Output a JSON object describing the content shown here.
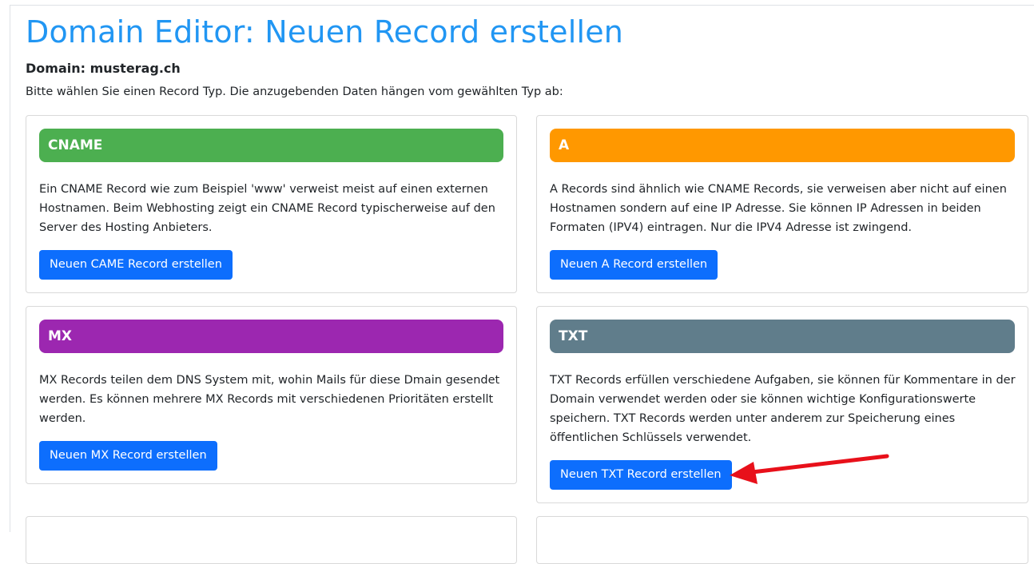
{
  "page": {
    "title": "Domain Editor: Neuen Record erstellen",
    "domain_line": "Domain: musterag.ch",
    "intro": "Bitte wählen Sie einen Record Typ. Die anzugebenden Daten hängen vom gewählten Typ ab:"
  },
  "cards": {
    "cname": {
      "header": "CNAME",
      "color": "#4caf50",
      "text": "Ein CNAME Record wie zum Beispiel 'www' verweist meist auf einen externen Hostnamen. Beim Webhosting zeigt ein CNAME Record typischerweise auf den Server des Hosting Anbieters.",
      "button": "Neuen CAME Record erstellen"
    },
    "a": {
      "header": "A",
      "color": "#ff9800",
      "text": "A Records sind ähnlich wie CNAME Records, sie verweisen aber nicht auf einen Hostnamen sondern auf eine IP Adresse. Sie können IP Adressen in beiden Formaten (IPV4) eintragen. Nur die IPV4 Adresse ist zwingend.",
      "button": "Neuen A Record erstellen"
    },
    "mx": {
      "header": "MX",
      "color": "#9c27b0",
      "text": "MX Records teilen dem DNS System mit, wohin Mails für diese Dmain gesendet werden. Es können mehrere MX Records mit verschiedenen Prioritäten erstellt werden.",
      "button": "Neuen MX Record erstellen"
    },
    "txt": {
      "header": "TXT",
      "color": "#607d8b",
      "text": "TXT Records erfüllen verschiedene Aufgaben, sie können für Kommentare in der Domain verwendet werden oder sie können wichtige Konfigurationswerte speichern. TXT Records werden unter anderem zur Speicherung eines öffentlichen Schlüssels verwendet.",
      "button": "Neuen TXT Record erstellen"
    }
  },
  "colors": {
    "title": "#2196f3",
    "button": "#0d6efd",
    "annotation_arrow": "#e8101a"
  },
  "annotation": {
    "icon": "red-arrow-icon"
  }
}
